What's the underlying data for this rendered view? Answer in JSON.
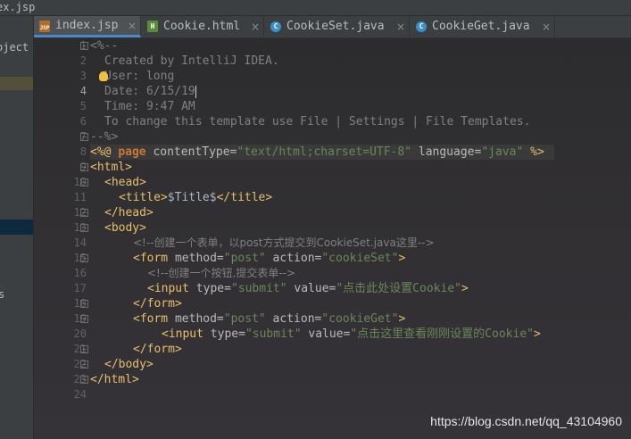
{
  "window": {
    "title_fragment": "ex.jsp"
  },
  "project_panel": {
    "label_fragment": "oject",
    "label_fragment2": "s"
  },
  "tabs": [
    {
      "label": "index.jsp",
      "icon": "jsp-file-icon",
      "active": true
    },
    {
      "label": "Cookie.html",
      "icon": "html-file-icon",
      "active": false
    },
    {
      "label": "CookieSet.java",
      "icon": "java-class-icon",
      "active": false
    },
    {
      "label": "CookieGet.java",
      "icon": "java-class-icon",
      "active": false
    }
  ],
  "close_glyph": "×",
  "current_line": 4,
  "code": {
    "l1": "<%--",
    "l2": "Created by IntelliJ IDEA.",
    "l3": "User: long",
    "l4": "Date: 6/15/19",
    "l5": "Time: 9:47 AM",
    "l6": "To change this template use File | Settings | File Templates.",
    "l7": "--%>",
    "l8": {
      "open": "<%@ ",
      "page": "page",
      "a1": " contentType=",
      "v1": "\"text/html;charset=UTF-8\"",
      "a2": " language=",
      "v2": "\"java\"",
      "close": " %>"
    },
    "l9": "<html>",
    "l10": "<head>",
    "l11": {
      "o": "<title>",
      "t": "$Title$",
      "c": "</title>"
    },
    "l12": "</head>",
    "l13": "<body>",
    "l14": "<!--创建一个表单，以post方式提交到CookieSet.java这里-->",
    "l15": {
      "o": "<form",
      "a1": " method=",
      "v1": "\"post\"",
      "a2": " action=",
      "v2": "\"cookieSet\"",
      "c": ">"
    },
    "l16": "<!--创建一个按钮,提交表单-->",
    "l17": {
      "o": "<input",
      "a1": " type=",
      "v1": "\"submit\"",
      "a2": " value=",
      "v2": "\"点击此处设置Cookie\"",
      "c": ">"
    },
    "l18": "</form>",
    "l19": {
      "o": "<form",
      "a1": " method=",
      "v1": "\"post\"",
      "a2": " action=",
      "v2": "\"cookieGet\"",
      "c": ">"
    },
    "l20": {
      "o": "<input",
      "a1": " type=",
      "v1": "\"submit\"",
      "a2": " value=",
      "v2": "\"点击这里查看刚刚设置的Cookie\"",
      "c": ">"
    },
    "l21": "</form>",
    "l22": "</body>",
    "l23": "</html>",
    "l24": ""
  },
  "line_numbers": [
    "1",
    "2",
    "3",
    "4",
    "5",
    "6",
    "7",
    "8",
    "9",
    "10",
    "11",
    "12",
    "13",
    "14",
    "15",
    "16",
    "17",
    "18",
    "19",
    "20",
    "21",
    "22",
    "23",
    "24"
  ],
  "watermark": "https://blog.csdn.net/qq_43104960",
  "colors": {
    "background": "#2b2b2b",
    "tag": "#e8bf6a",
    "string": "#6a8759",
    "comment": "#808080",
    "keyword": "#cc7832",
    "active_tab_underline": "#4a88c7"
  }
}
